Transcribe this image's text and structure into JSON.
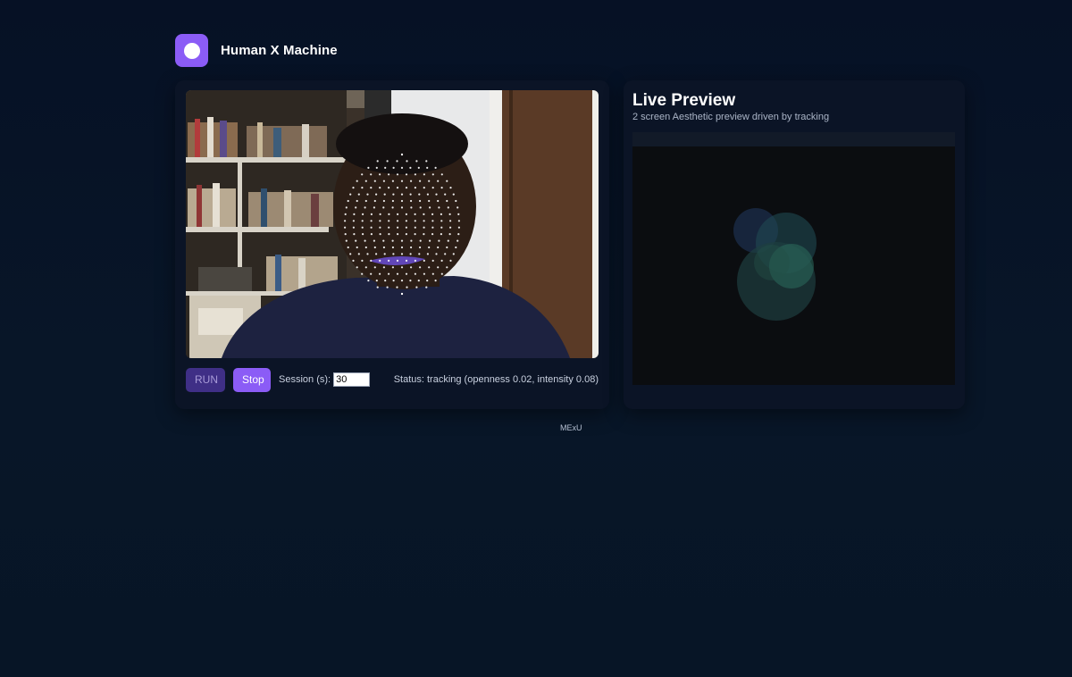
{
  "app": {
    "title": "Human X Machine",
    "accent_color": "#8b5cf6"
  },
  "camera": {
    "controls": {
      "run_label": "RUN",
      "stop_label": "Stop",
      "session_label": "Session (s):",
      "session_value": "30",
      "status_text": "Status: tracking (openness 0.02, intensity 0.08)"
    }
  },
  "preview": {
    "title": "Live Preview",
    "subtitle": "2 screen Aesthetic preview driven by tracking"
  },
  "footer": {
    "text": "MExU"
  }
}
